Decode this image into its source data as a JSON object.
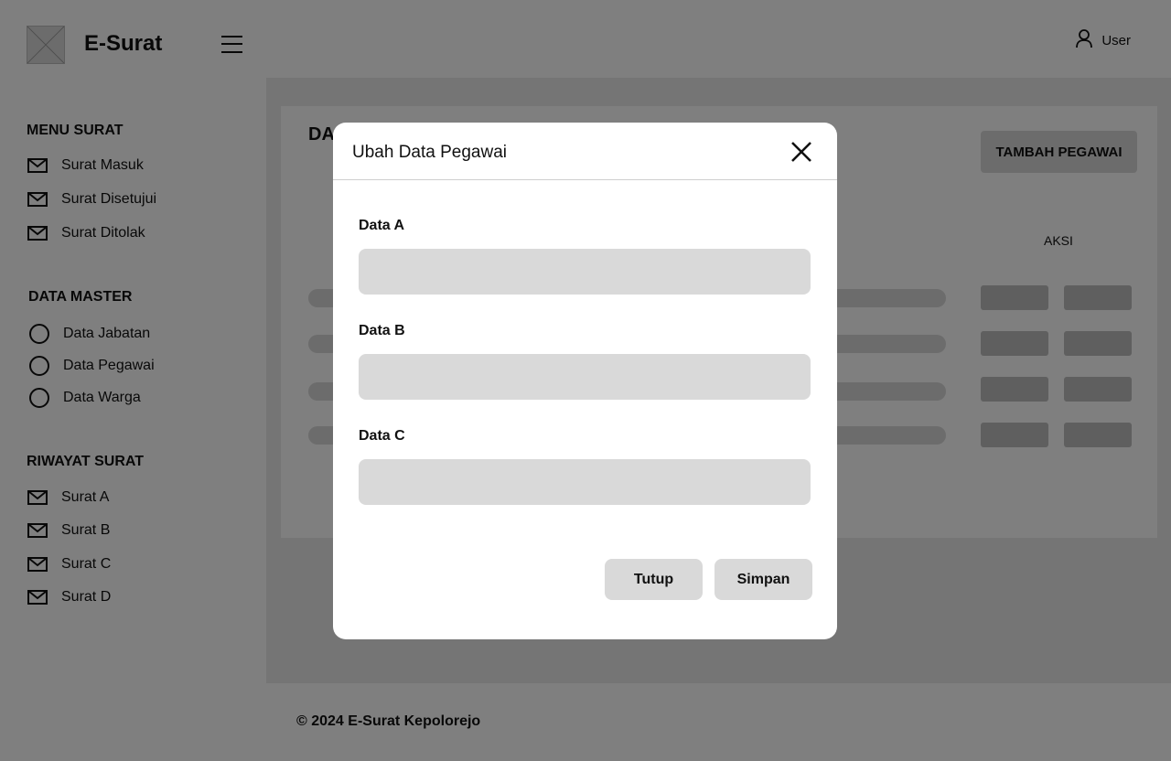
{
  "app": {
    "title": "E-Surat"
  },
  "sidebar": {
    "sections": [
      {
        "title": "MENU SURAT",
        "items": [
          {
            "label": "Surat Masuk",
            "icon": "mail-icon"
          },
          {
            "label": "Surat Disetujui",
            "icon": "mail-icon"
          },
          {
            "label": "Surat Ditolak",
            "icon": "mail-icon"
          }
        ]
      },
      {
        "title": "DATA MASTER",
        "items": [
          {
            "label": "Data Jabatan",
            "icon": "circle-icon"
          },
          {
            "label": "Data Pegawai",
            "icon": "circle-icon"
          },
          {
            "label": "Data Warga",
            "icon": "circle-icon"
          }
        ]
      },
      {
        "title": "RIWAYAT SURAT",
        "items": [
          {
            "label": "Surat A",
            "icon": "mail-icon"
          },
          {
            "label": "Surat B",
            "icon": "mail-icon"
          },
          {
            "label": "Surat C",
            "icon": "mail-icon"
          },
          {
            "label": "Surat D",
            "icon": "mail-icon"
          }
        ]
      }
    ]
  },
  "header": {
    "user_label": "User"
  },
  "main": {
    "card_title": "DA",
    "add_button": "TAMBAH PEGAWAI",
    "table": {
      "action_header": "AKSI"
    }
  },
  "footer": {
    "text": "© 2024 E-Surat Kepolorejo"
  },
  "modal": {
    "title": "Ubah Data Pegawai",
    "fields": [
      {
        "label": "Data A",
        "value": "",
        "placeholder": ""
      },
      {
        "label": "Data B",
        "value": "",
        "placeholder": ""
      },
      {
        "label": "Data C",
        "value": "",
        "placeholder": ""
      }
    ],
    "close_button": "Tutup",
    "save_button": "Simpan"
  },
  "colors": {
    "overlay": "#000000",
    "placeholder_gray": "#d9d9d9",
    "text": "#111111"
  }
}
